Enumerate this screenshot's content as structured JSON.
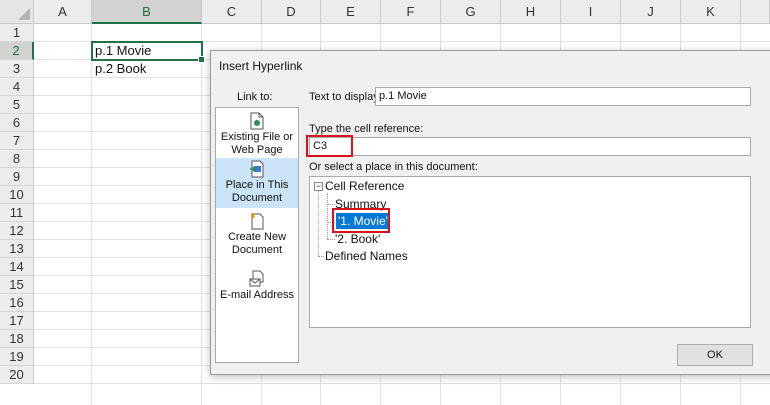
{
  "sheet": {
    "columns": [
      "A",
      "B",
      "C",
      "D",
      "E",
      "F",
      "G",
      "H",
      "I",
      "J",
      "K"
    ],
    "rows": [
      "1",
      "2",
      "3",
      "4",
      "5",
      "6",
      "7",
      "8",
      "9",
      "10",
      "11",
      "12",
      "13",
      "14",
      "15",
      "16",
      "17",
      "18",
      "19",
      "20"
    ],
    "cells": {
      "B2": "p.1 Movie",
      "B3": "p.2 Book"
    }
  },
  "dialog": {
    "title": "Insert Hyperlink",
    "link_to_label": "Link to:",
    "link_to": [
      {
        "line1": "Existing File or",
        "line2": "Web Page",
        "icon": "existing-file-icon"
      },
      {
        "line1": "Place in This",
        "line2": "Document",
        "icon": "place-in-document-icon"
      },
      {
        "line1": "Create New",
        "line2": "Document",
        "icon": "new-document-icon"
      },
      {
        "line1": "E-mail Address",
        "line2": "",
        "icon": "email-icon"
      }
    ],
    "text_to_display_label": "Text to display:",
    "text_to_display_value": "p.1 Movie",
    "cell_reference_label": "Type the cell reference:",
    "cell_reference_value": "C3",
    "place_label": "Or select a place in this document:",
    "tree": {
      "root": "Cell Reference",
      "children": [
        "Summary",
        "'1. Movie'",
        "'2. Book'"
      ],
      "defined_names": "Defined Names"
    },
    "ok_label": "OK"
  },
  "colors": {
    "excel_green": "#217346",
    "highlight_red": "#d9121b",
    "selection_blue": "#0078d7",
    "panel_selected": "#cce4f7"
  }
}
